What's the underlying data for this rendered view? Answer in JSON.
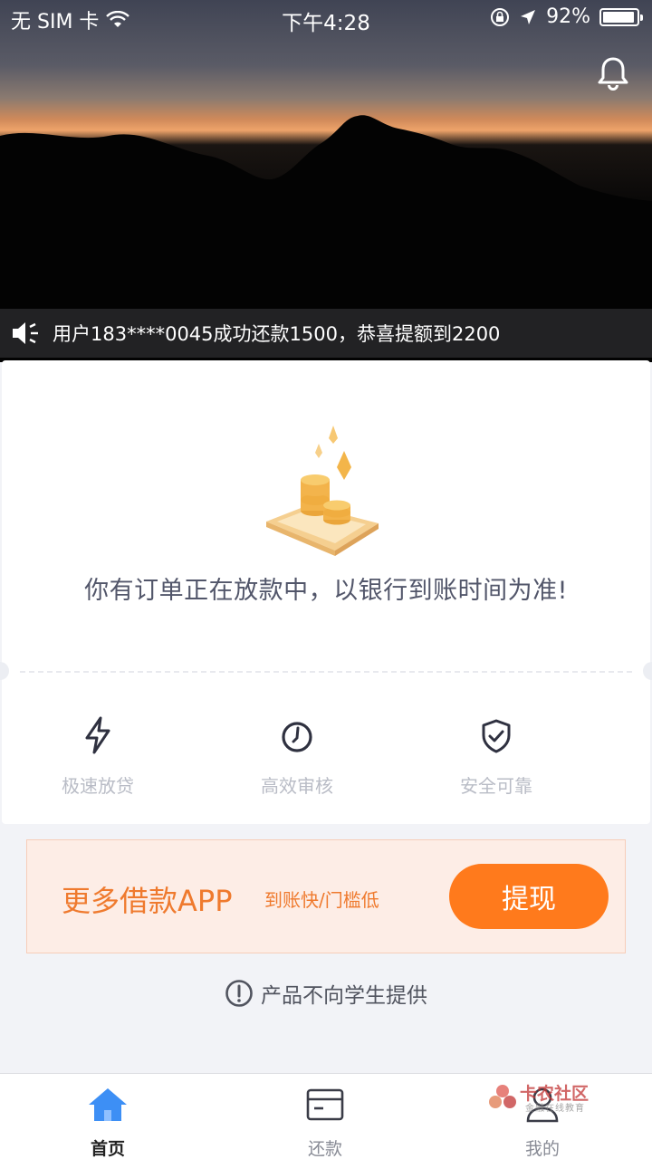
{
  "status_bar": {
    "carrier": "无 SIM 卡",
    "time": "下午4:28",
    "battery": "92%"
  },
  "marquee": {
    "text": "用户183****0045成功还款1500，恭喜提额到2200"
  },
  "order": {
    "message": "你有订单正在放款中，以银行到账时间为准!"
  },
  "features": [
    {
      "label": "极速放贷",
      "icon": "lightning-icon"
    },
    {
      "label": "高效审核",
      "icon": "clock-icon"
    },
    {
      "label": "安全可靠",
      "icon": "shield-check-icon"
    }
  ],
  "promo": {
    "title": "更多借款APP",
    "subtitle": "到账快/门槛低",
    "button_label": "提现"
  },
  "notice": {
    "text": "产品不向学生提供"
  },
  "tabbar": {
    "tabs": [
      {
        "label": "首页",
        "icon": "home-icon",
        "active": true
      },
      {
        "label": "还款",
        "icon": "card-icon",
        "active": false
      },
      {
        "label": "我的",
        "icon": "user-icon",
        "active": false
      }
    ]
  },
  "watermark": {
    "text": "卡农社区",
    "subtext": "金融在线教育"
  },
  "colors": {
    "accent_orange": "#ff7a1c",
    "tab_active_blue": "#3d8ff5",
    "promo_background": "#fdede6"
  }
}
